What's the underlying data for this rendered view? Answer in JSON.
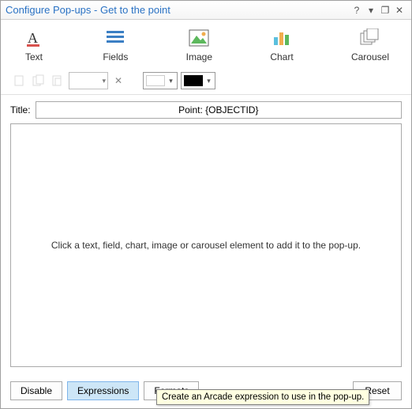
{
  "window": {
    "title": "Configure Pop-ups - Get to the point",
    "help": "?",
    "dropdown": "▾",
    "restore": "❐",
    "close": "✕"
  },
  "toolbar": {
    "text_label": "Text",
    "fields_label": "Fields",
    "image_label": "Image",
    "chart_label": "Chart",
    "carousel_label": "Carousel"
  },
  "secondbar": {
    "fill_color": "#ffffff",
    "stroke_color": "#000000"
  },
  "title_field": {
    "label": "Title:",
    "value": "Point: {OBJECTID}"
  },
  "canvas": {
    "placeholder": "Click a text, field, chart, image or carousel element to add it to the pop-up."
  },
  "buttons": {
    "disable": "Disable",
    "expressions": "Expressions",
    "formats": "Formats",
    "reset": "Reset"
  },
  "tooltip": "Create an Arcade expression to use in the pop-up."
}
